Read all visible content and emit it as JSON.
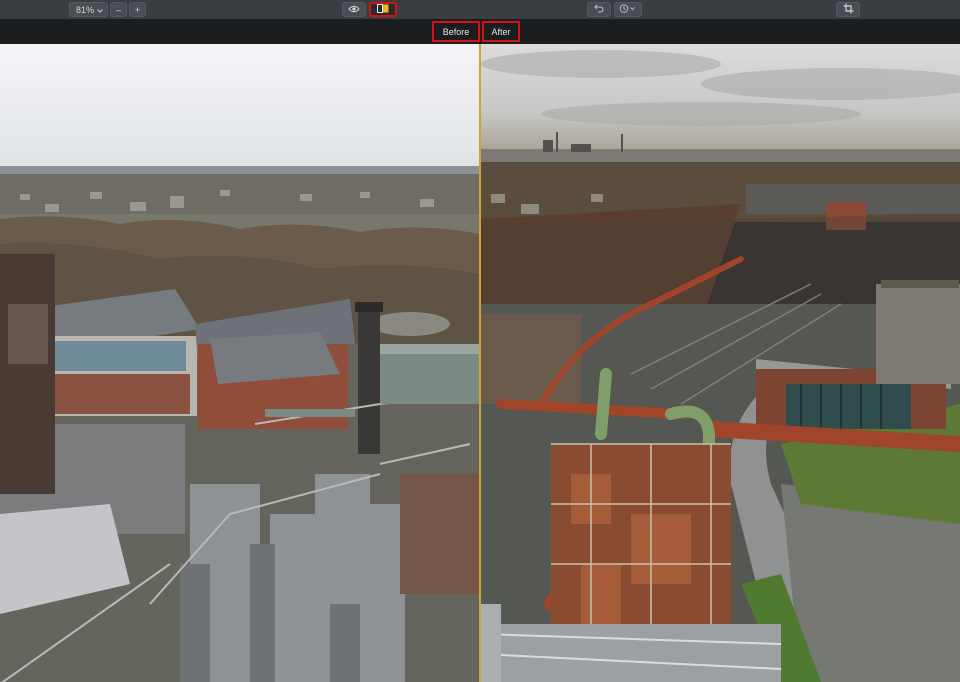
{
  "toolbar": {
    "zoom_value": "81%",
    "zoom_out_glyph": "–",
    "zoom_in_glyph": "+",
    "icons": {
      "zoom_dropdown": "chevron-down-icon",
      "preview": "eye-icon",
      "compare": "split-compare-icon",
      "undo": "undo-icon",
      "history": "history-icon",
      "crop": "crop-icon"
    }
  },
  "compare_bar": {
    "before_label": "Before",
    "after_label": "After"
  },
  "colors": {
    "highlight_border": "#d41414",
    "divider": "#d2a23a",
    "toolbar_bg": "#3a3d42",
    "bar_bg": "#1c1d1f"
  }
}
